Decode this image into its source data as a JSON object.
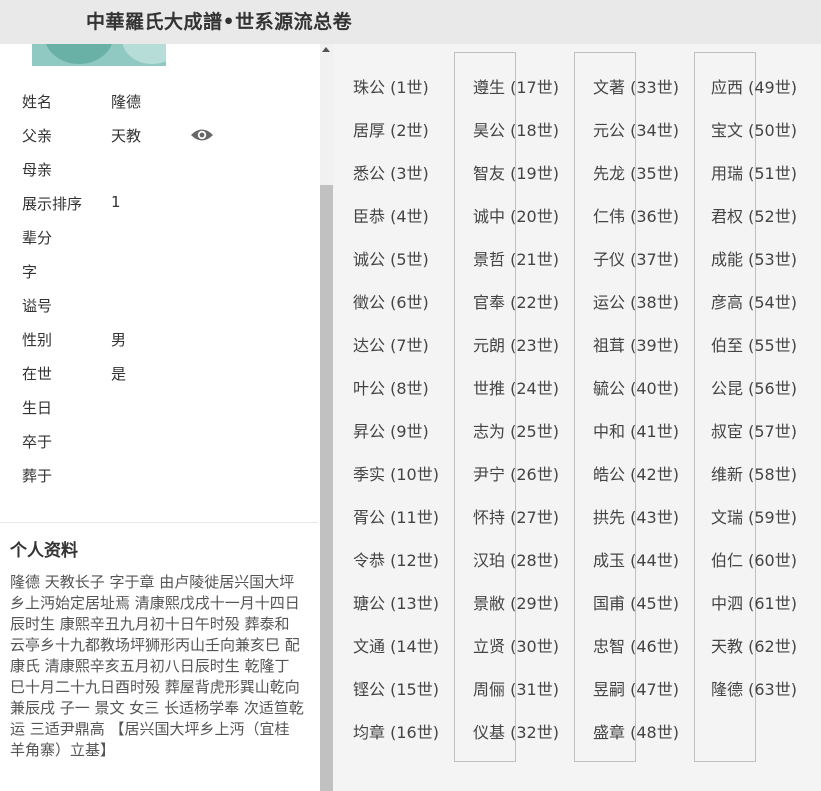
{
  "header": {
    "title": "中華羅氏大成譜•世系源流总卷"
  },
  "profile": {
    "rows": [
      {
        "label": "姓名",
        "value": "隆德"
      },
      {
        "label": "父亲",
        "value": "天教"
      },
      {
        "label": "母亲",
        "value": ""
      },
      {
        "label": "展示排序",
        "value": "1"
      },
      {
        "label": "辈分",
        "value": ""
      },
      {
        "label": "字",
        "value": ""
      },
      {
        "label": "谥号",
        "value": ""
      },
      {
        "label": "性别",
        "value": "男"
      },
      {
        "label": "在世",
        "value": "是"
      },
      {
        "label": "生日",
        "value": ""
      },
      {
        "label": "卒于",
        "value": ""
      },
      {
        "label": "葬于",
        "value": ""
      }
    ],
    "eye_icon": "eye-icon"
  },
  "personal": {
    "heading": "个人资料",
    "text": "隆德 天教长子 字于章 由卢陵徙居兴国大坪乡上沔始定居址焉 清康熙戊戌十一月十四日辰时生 康熙辛丑九月初十日午时殁 葬泰和云亭乡十九都教场坪狮形丙山壬向兼亥巳 配康氏 清康熙辛亥五月初八日辰时生 乾隆丁巳十月二十九日酉时殁 葬屋背虎形巽山乾向兼辰戌 子一 景文 女三 长适杨学奉 次适笪乾运 三适尹鼎高 【居兴国大坪乡上沔（宜桂羊角寨）立基】"
  },
  "generations": [
    [
      "珠公 (1世)",
      "居厚 (2世)",
      "悉公 (3世)",
      "臣恭 (4世)",
      "诚公 (5世)",
      "徵公 (6世)",
      "达公 (7世)",
      "叶公 (8世)",
      "昇公 (9世)",
      "季实 (10世)",
      "胥公 (11世)",
      "令恭 (12世)",
      "瑭公 (13世)",
      "文通 (14世)",
      "铿公 (15世)",
      "均章 (16世)"
    ],
    [
      "遵生 (17世)",
      "昊公 (18世)",
      "智友 (19世)",
      "诚中 (20世)",
      "景哲 (21世)",
      "官奉 (22世)",
      "元朗 (23世)",
      "世推 (24世)",
      "志为 (25世)",
      "尹宁 (26世)",
      "怀持 (27世)",
      "汉珀 (28世)",
      "景敝 (29世)",
      "立贤 (30世)",
      "周俪 (31世)",
      "仪基 (32世)"
    ],
    [
      "文著 (33世)",
      "元公 (34世)",
      "先龙 (35世)",
      "仁伟 (36世)",
      "子仪 (37世)",
      "运公 (38世)",
      "祖茸 (39世)",
      "毓公 (40世)",
      "中和 (41世)",
      "皓公 (42世)",
      "拱先 (43世)",
      "成玉 (44世)",
      "国甫 (45世)",
      "忠智 (46世)",
      "昱嗣 (47世)",
      "盛章 (48世)"
    ],
    [
      "应西 (49世)",
      "宝文 (50世)",
      "用瑞 (51世)",
      "君权 (52世)",
      "成能 (53世)",
      "彦高 (54世)",
      "伯至 (55世)",
      "公昆 (56世)",
      "叔宦 (57世)",
      "维新 (58世)",
      "文瑞 (59世)",
      "伯仁 (60世)",
      "中泗 (61世)",
      "天教 (62世)",
      "隆德 (63世)"
    ]
  ]
}
